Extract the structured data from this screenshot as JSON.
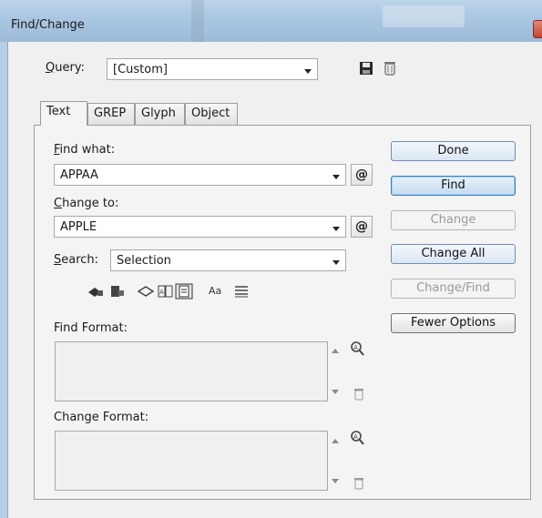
{
  "window": {
    "title": "Find/Change"
  },
  "query": {
    "label_prefix": "",
    "label_access": "Q",
    "label_rest": "uery:",
    "value": "[Custom]"
  },
  "tabs": [
    {
      "label": "Text"
    },
    {
      "label": "GREP"
    },
    {
      "label": "Glyph"
    },
    {
      "label": "Object"
    }
  ],
  "find_what": {
    "label_access": "F",
    "label_rest": "ind what:",
    "value": "APPAA",
    "special_char_glyph": "@"
  },
  "change_to": {
    "label_access": "C",
    "label_rest": "hange to:",
    "value": "APPLE",
    "special_char_glyph": "@"
  },
  "search": {
    "label_access": "S",
    "label_rest": "earch:",
    "value": "Selection"
  },
  "option_icons": [
    "include-locked-layers-icon",
    "include-locked-stories-icon",
    "include-hidden-layers-icon",
    "include-master-pages-icon",
    "include-footnotes-icon",
    "case-sensitive-icon",
    "whole-word-icon"
  ],
  "case_sensitive_glyph": "Aa",
  "find_format": {
    "label": "Find Format:"
  },
  "change_format": {
    "label": "Change Format:"
  },
  "buttons": {
    "done": "Done",
    "find": "Find",
    "change": "Change",
    "change_all": "Change All",
    "change_find": "Change/Find",
    "fewer_options": "Fewer Options"
  }
}
